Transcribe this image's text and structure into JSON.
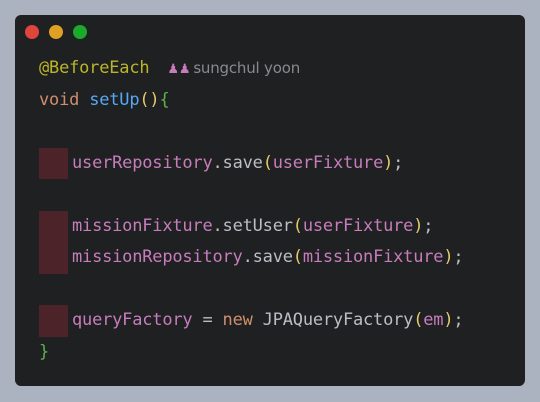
{
  "window": {
    "controls": [
      {
        "name": "close",
        "color": "#e0443e"
      },
      {
        "name": "minimize",
        "color": "#dea123"
      },
      {
        "name": "maximize",
        "color": "#1aab29"
      }
    ]
  },
  "code": {
    "annotation": "@BeforeEach",
    "author": "sungchul yoon",
    "author_icon": "people-icon",
    "signature": {
      "return_type": "void",
      "method": "setUp",
      "parens": "()",
      "open_brace": "{"
    },
    "line_user_save": {
      "receiver": "userRepository",
      "call": ".save",
      "arg": "userFixture"
    },
    "line_mission_setuser": {
      "receiver": "missionFixture",
      "call": ".setUser",
      "arg": "userFixture"
    },
    "line_mission_save": {
      "receiver": "missionRepository",
      "call": ".save",
      "arg": "missionFixture"
    },
    "line_query": {
      "field": "queryFactory",
      "assign": " = ",
      "new_kw": "new",
      "type": " JPAQueryFactory",
      "arg": "em"
    },
    "close_brace": "}",
    "semicolon": ";",
    "lparen": "(",
    "rparen": ")"
  }
}
